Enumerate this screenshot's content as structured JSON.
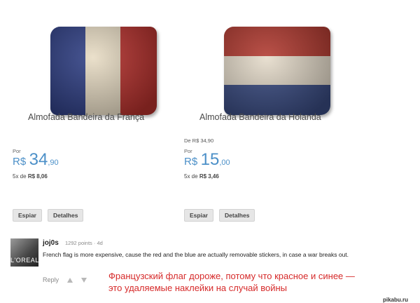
{
  "products": [
    {
      "name": "Almofada Bandeira da França",
      "old_price": "",
      "por_label": "Por",
      "currency": "R$",
      "price_int": "34",
      "price_dec": ",90",
      "installment_prefix": "5x de",
      "installment_value": "R$ 8,06",
      "btn_spy": "Espiar",
      "btn_details": "Detalhes",
      "flag_colors": [
        "#2f3f85",
        "#e8dcc4",
        "#b8322e"
      ]
    },
    {
      "name": "Almofada Bandeira da Holanda",
      "old_price": "De R$ 34,90",
      "por_label": "Por",
      "currency": "R$",
      "price_int": "15",
      "price_dec": ",00",
      "installment_prefix": "5x de",
      "installment_value": "R$ 3,46",
      "btn_spy": "Espiar",
      "btn_details": "Detalhes",
      "flag_colors": [
        "#b23a30",
        "#e6dccb",
        "#3b4d84"
      ]
    }
  ],
  "comment": {
    "username": "joj0s",
    "meta": "1292 points · 4d",
    "avatar_text": "L'OREAL",
    "text": "French flag is more expensive, cause the red and the blue are actually removable stickers, in case a war breaks out.",
    "reply_label": "Reply"
  },
  "translation": "Французский флаг дороже, потому что красное и синее — это удаляемые наклейки на случай войны",
  "watermark": "pikabu.ru"
}
